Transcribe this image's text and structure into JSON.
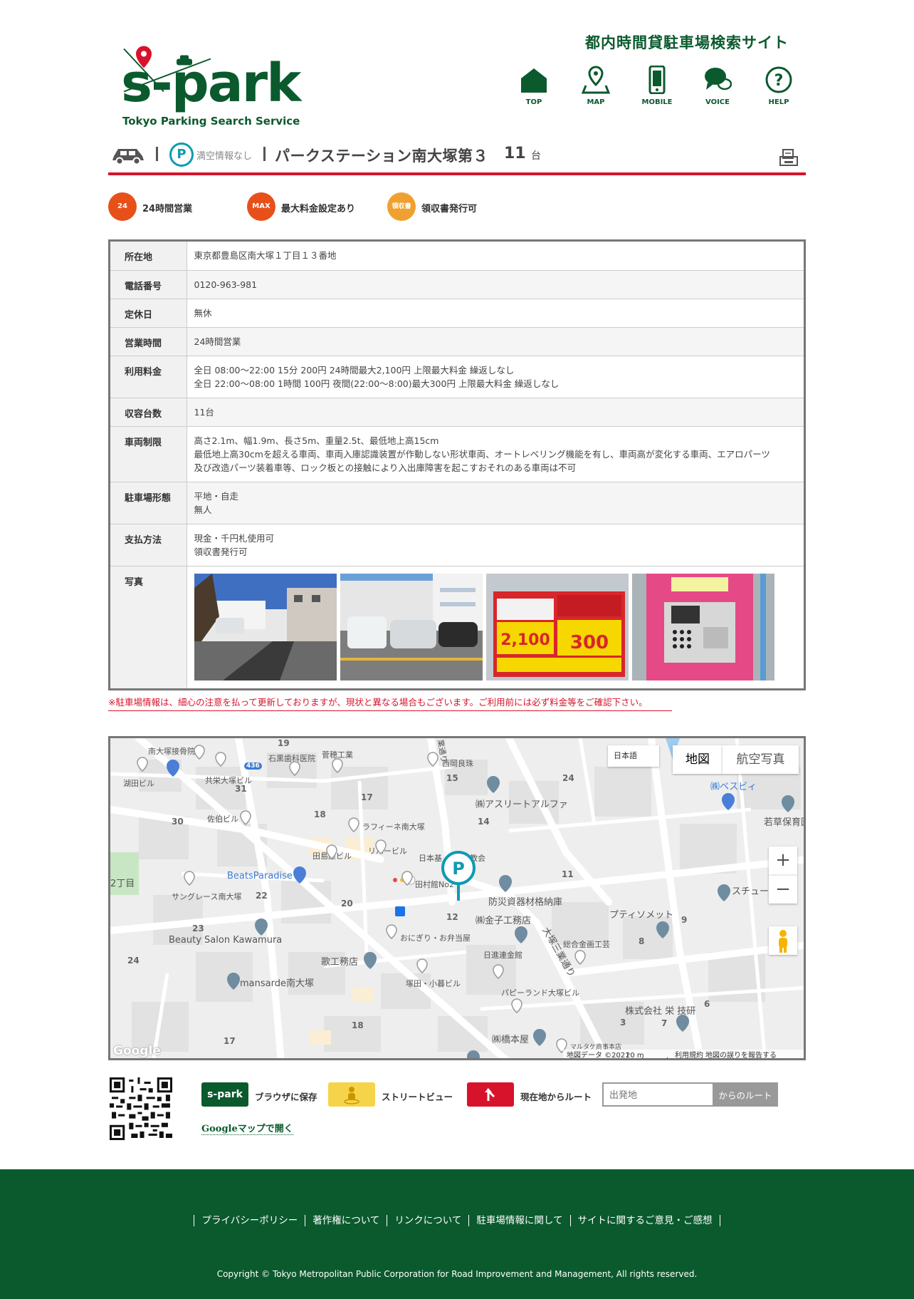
{
  "header": {
    "logo_text": "s-park",
    "logo_subtitle": "Tokyo Parking Search Service",
    "site_title": "都内時間貸駐車場検索サイト",
    "nav": [
      {
        "label": "TOP",
        "icon": "home-icon"
      },
      {
        "label": "MAP",
        "icon": "map-icon"
      },
      {
        "label": "MOBILE",
        "icon": "mobile-icon"
      },
      {
        "label": "VOICE",
        "icon": "voice-icon"
      },
      {
        "label": "HELP",
        "icon": "help-icon"
      }
    ]
  },
  "parking": {
    "availability_icon": "P",
    "availability": "満空情報なし",
    "name": "パークステーション南大塚第３",
    "count": "11",
    "count_unit": "台"
  },
  "features": [
    {
      "label": "24時間営業",
      "icon_text": "24"
    },
    {
      "label": "最大料金設定あり",
      "icon_text": "MAX"
    },
    {
      "label": "領収書発行可",
      "icon_text": "領収書"
    }
  ],
  "info": {
    "address": {
      "label": "所在地",
      "value": "東京都豊島区南大塚１丁目１３番地"
    },
    "phone": {
      "label": "電話番号",
      "value": "0120-963-981"
    },
    "holiday": {
      "label": "定休日",
      "value": "無休"
    },
    "hours": {
      "label": "営業時間",
      "value": "24時間営業"
    },
    "fee": {
      "label": "利用料金",
      "lines": [
        "全日 08:00～22:00 15分 200円 24時間最大2,100円 上限最大料金 繰返しなし",
        "全日 22:00～08:00 1時間 100円 夜間(22:00～8:00)最大300円 上限最大料金 繰返しなし"
      ]
    },
    "capacity": {
      "label": "収容台数",
      "value": "11台"
    },
    "restriction": {
      "label": "車両制限",
      "lines": [
        "高さ2.1m、幅1.9m、長さ5m、重量2.5t、最低地上高15cm",
        "最低地上高30cmを超える車両、車両入庫認識装置が作動しない形状車両、オートレベリング機能を有し、車両高が変化する車両、エアロパーツ",
        "及び改造パーツ装着車等、ロック板との接触により入出庫障害を起こすおそれのある車両は不可"
      ]
    },
    "type": {
      "label": "駐車場形態",
      "lines": [
        "平地・自走",
        "無人"
      ]
    },
    "payment": {
      "label": "支払方法",
      "lines": [
        "現金・千円札使用可",
        "領収書発行可"
      ]
    },
    "photos": {
      "label": "写真"
    }
  },
  "notice": "※駐車場情報は、細心の注意を払って更新しておりますが、現状と異なる場合もございます。ご利用前には必ず料金等をご確認下さい。",
  "map": {
    "lang_select": "日本語",
    "tab_map": "地図",
    "tab_aerial": "航空写真",
    "zoom_in": "+",
    "zoom_out": "−",
    "parking_marker": "P",
    "labels": {
      "l1": "南大塚接骨院",
      "l2": "石黒歯科医院",
      "l3": "菅穂工業",
      "l4": "西岡良珠",
      "l5": "湖田ビル",
      "l6": "共栄大塚ビル",
      "l7": "佐伯ビル",
      "l8": "ラフィーネ南大塚",
      "l9": "田島屋ビル",
      "l10": "リバービル",
      "l11": "日本基",
      "l12": "教会",
      "l13": "田村館No2",
      "l14": "BeatsParadise",
      "l15": "サングレース南大塚",
      "l16": "Beauty Salon Kawamura",
      "l17": "歌工務店",
      "l18": "おにぎり・お弁当屋",
      "l19": "日進連金館",
      "l20": "塚田・小暮ビル",
      "l21": "mansarde南大塚",
      "l22": "㈱アスリートアルファ",
      "l23": "防災資器材格納庫",
      "l24": "㈱金子工務店",
      "l25": "大塚三業通り",
      "l26": "総合金画工芸",
      "l27": "パピーランド大塚ビル",
      "l28": "㈱橋本屋",
      "l29": "プティソメット",
      "l30": "株式会社 栄 技研",
      "l31": "㈱ベスビィ",
      "l32": "若草保育園",
      "l33": "スチュー",
      "l34": "2丁目",
      "l35": "業通り",
      "l36": "マルタケ商事本店"
    },
    "numbers": {
      "n1": "19",
      "n2": "436",
      "n3": "15",
      "n4": "24",
      "n5": "31",
      "n6": "17",
      "n7": "30",
      "n8": "18",
      "n9": "14",
      "n10": "11",
      "n11": "22",
      "n12": "20",
      "n13": "12",
      "n14": "23",
      "n15": "9",
      "n16": "8",
      "n17": "24",
      "n18": "6",
      "n19": "3",
      "n20": "7",
      "n21": "18",
      "n22": "17"
    },
    "attribution": {
      "data": "地図データ ©2021",
      "scale": "20 m",
      "terms": "利用規約",
      "report": "地図の誤りを報告する",
      "google": "Google"
    }
  },
  "tools": {
    "save_icon_text": "s-park",
    "save_label": "ブラウザに保存",
    "street_label": "ストリートビュー",
    "route_label": "現在地からルート",
    "route_placeholder": "出発地",
    "route_button": "からのルート",
    "gmap_link": "Googleマップで開く"
  },
  "footer": {
    "links": [
      "プライバシーポリシー",
      "著作権について",
      "リンクについて",
      "駐車場情報に関して",
      "サイトに関するご意見・ご感想"
    ],
    "copyright": "Copyright © Tokyo Metropolitan  Public Corporation  for Road Improvement and  Management, All rights reserved."
  },
  "colors": {
    "brand_green": "#0b5a2e",
    "accent_red": "#d7132b",
    "feature_orange": "#e8501a",
    "parking_teal": "#0e9bb2"
  }
}
